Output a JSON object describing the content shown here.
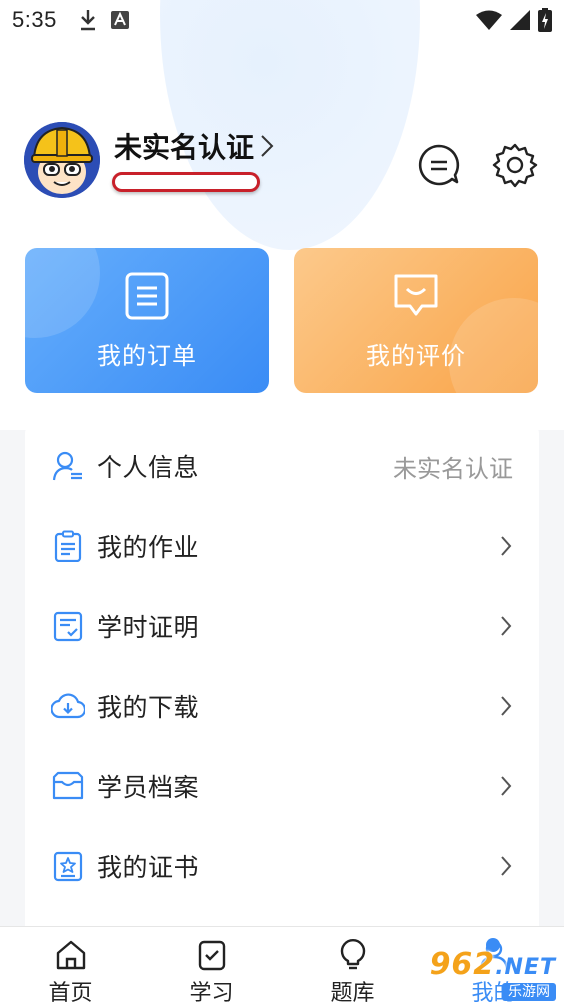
{
  "status_bar": {
    "time": "5:35",
    "icons": [
      "download-icon",
      "a-badge-icon",
      "wifi-icon",
      "signal-icon",
      "battery-charging-icon"
    ]
  },
  "profile": {
    "name": "未实名认证",
    "arrow": "›"
  },
  "cards": [
    {
      "label": "我的订单",
      "icon": "list-document-icon",
      "color": "#3a8cf5"
    },
    {
      "label": "我的评价",
      "icon": "message-box-icon",
      "color": "#f9a448"
    }
  ],
  "menu": {
    "items": [
      {
        "label": "个人信息",
        "value": "未实名认证",
        "icon": "user-info-icon"
      },
      {
        "label": "我的作业",
        "icon": "clipboard-icon"
      },
      {
        "label": "学时证明",
        "icon": "certificate-check-icon"
      },
      {
        "label": "我的下载",
        "icon": "cloud-download-icon"
      },
      {
        "label": "学员档案",
        "icon": "archive-box-icon"
      },
      {
        "label": "我的证书",
        "icon": "certificate-star-icon"
      }
    ]
  },
  "bottom_nav": {
    "items": [
      {
        "label": "首页",
        "icon": "home-icon"
      },
      {
        "label": "学习",
        "icon": "study-check-icon"
      },
      {
        "label": "题库",
        "icon": "lightbulb-icon"
      },
      {
        "label": "我的",
        "icon": "profile-icon"
      }
    ]
  },
  "watermark": {
    "main": "962",
    "suffix": ".NET",
    "sub": "乐游网"
  },
  "colors": {
    "accent_blue": "#3a8cf5",
    "accent_orange": "#f9a448",
    "background": "#f5f6f8"
  }
}
